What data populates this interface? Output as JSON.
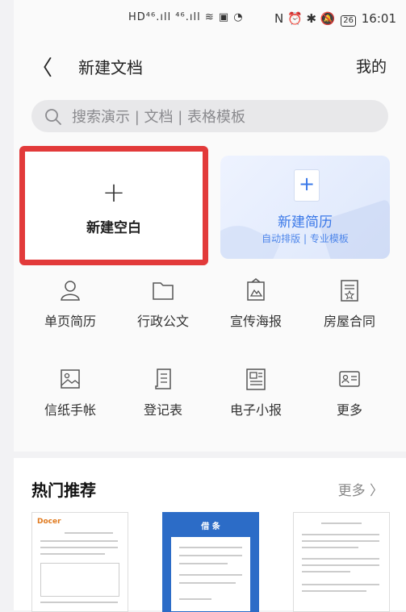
{
  "status_bar": {
    "left_icons": "HD⁴⁶.ıll ⁴⁶.ıll ≋ ▣ ◔",
    "right_icons": "N ⏰ ✱ 🔕",
    "battery": "26",
    "time": "16:01"
  },
  "nav": {
    "back": "〈",
    "title": "新建文档",
    "mine": "我的"
  },
  "search": {
    "placeholder": "搜索演示 | 文档 | 表格模板"
  },
  "blank_card": {
    "plus": "+",
    "label": "新建空白"
  },
  "resume_card": {
    "plus": "+",
    "title": "新建简历",
    "subtitle": "自动排版 | 专业模板"
  },
  "grid": [
    {
      "label": "单页简历",
      "icon": "person-icon"
    },
    {
      "label": "行政公文",
      "icon": "folder-icon"
    },
    {
      "label": "宣传海报",
      "icon": "poster-icon"
    },
    {
      "label": "房屋合同",
      "icon": "contract-icon"
    },
    {
      "label": "信纸手帐",
      "icon": "image-icon"
    },
    {
      "label": "登记表",
      "icon": "scroll-icon"
    },
    {
      "label": "电子小报",
      "icon": "newspaper-icon"
    },
    {
      "label": "更多",
      "icon": "card-icon"
    }
  ],
  "hot": {
    "title": "热门推荐",
    "more": "更多 〉",
    "thumbs": [
      {
        "title": "Docer"
      },
      {
        "title": "借 条"
      },
      {
        "title": ""
      }
    ]
  },
  "colors": {
    "accent": "#3a78e8",
    "highlight_border": "#e23a3a"
  }
}
